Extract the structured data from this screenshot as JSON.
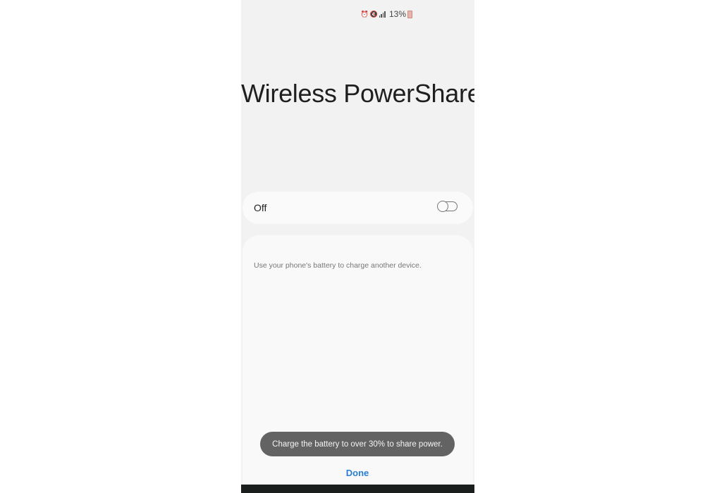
{
  "status_bar": {
    "alarm_icon": "alarm-icon",
    "mute_icon": "mute-icon",
    "signal_icon": "signal-icon",
    "battery_percent": "13%",
    "battery_icon": "battery-low-icon"
  },
  "page": {
    "title": "Wireless PowerShare"
  },
  "toggle": {
    "label": "Off",
    "state": "off"
  },
  "description": {
    "text": "Use your phone's battery to charge another device."
  },
  "toast": {
    "message": "Charge the battery to over 30% to share power."
  },
  "actions": {
    "done_label": "Done"
  },
  "colors": {
    "accent": "#2a7fd4",
    "toast_bg": "#636363",
    "battery_low": "#c98a80"
  }
}
